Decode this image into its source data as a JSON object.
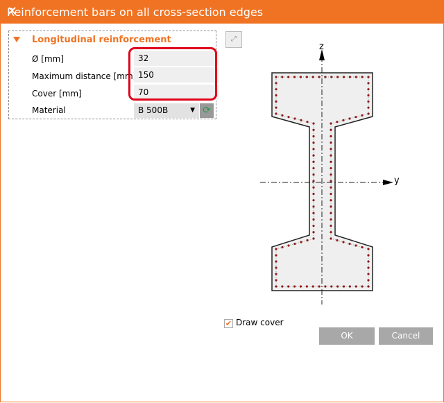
{
  "window": {
    "title": "Reinforcement bars on all cross-section edges",
    "close": "✕"
  },
  "section": {
    "header": "Longitudinal reinforcement",
    "fields": [
      {
        "label": "Ø [mm]",
        "value": "32"
      },
      {
        "label": "Maximum distance [mm]",
        "value": "150"
      },
      {
        "label": "Cover [mm]",
        "value": "70"
      }
    ],
    "material": {
      "label": "Material",
      "value": "B 500B"
    }
  },
  "drawing": {
    "z_axis": "z",
    "y_axis": "y",
    "bar_color": "#8b1a1a"
  },
  "draw_cover": {
    "label": "Draw cover",
    "checked": true
  },
  "buttons": {
    "ok": "OK",
    "cancel": "Cancel"
  },
  "colors": {
    "accent": "#f07324",
    "highlight": "#e0001a"
  }
}
